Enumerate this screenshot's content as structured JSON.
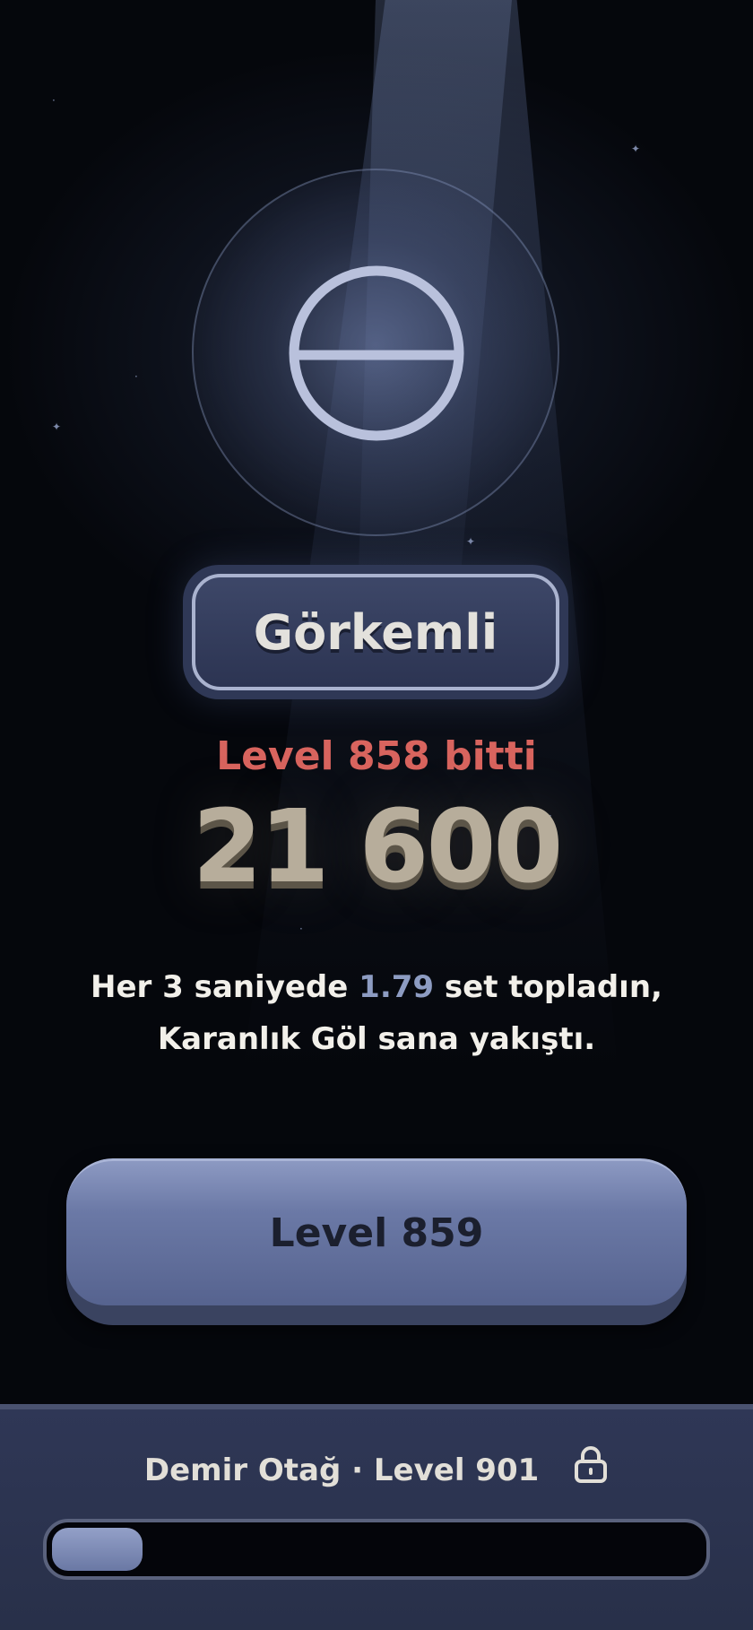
{
  "rank": {
    "label": "Görkemli"
  },
  "result": {
    "level_done_text": "Level 858 bitti",
    "score": "21 600"
  },
  "message": {
    "line1_prefix": "Her 3 saniyede ",
    "highlight_value": "1.79",
    "line1_suffix": " set topladın,",
    "line2": "Karanlık Göl sana yakıştı."
  },
  "next_button": {
    "label": "Level 859"
  },
  "footer": {
    "destination": "Demir Otağ · Level 901",
    "lock_icon": "lock-icon",
    "progress_fraction": 0.14
  },
  "colors": {
    "accent_red": "#d8645e",
    "score": "#b7ad9b",
    "highlight": "#8d9cc2",
    "button": "#6b79a6",
    "footer": "#2f3756"
  }
}
